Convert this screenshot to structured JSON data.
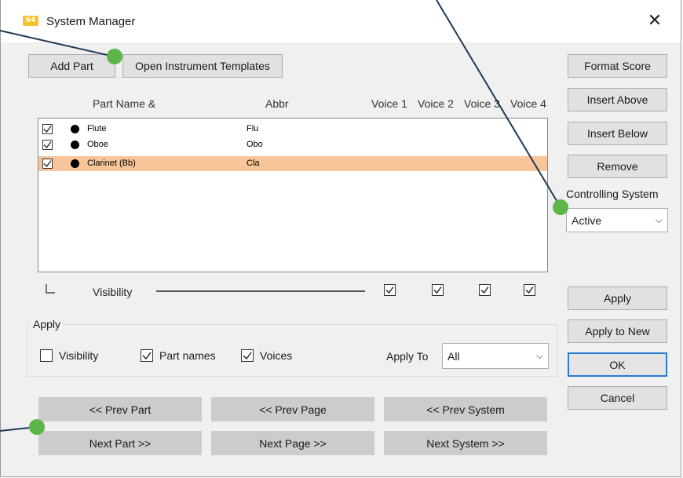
{
  "window": {
    "title": "System Manager",
    "app_icon_text": "64"
  },
  "top_buttons": {
    "add_part": "Add Part",
    "open_templates": "Open Instrument Templates"
  },
  "side_buttons": {
    "format_score": "Format Score",
    "insert_above": "Insert Above",
    "insert_below": "Insert Below",
    "remove": "Remove",
    "controlling_label": "Controlling System",
    "controlling_value": "Active",
    "apply": "Apply",
    "apply_to_new": "Apply to New",
    "ok": "OK",
    "cancel": "Cancel"
  },
  "columns": {
    "part_name": "Part Name &",
    "abbr": "Abbr",
    "voice1": "Voice 1",
    "voice2": "Voice 2",
    "voice3": "Voice 3",
    "voice4": "Voice 4"
  },
  "parts": [
    {
      "name": "Flute",
      "abbr": "Flu",
      "checked": true,
      "selected": false
    },
    {
      "name": "Oboe",
      "abbr": "Obo",
      "checked": true,
      "selected": false
    },
    {
      "name": "Clarinet (Bb)",
      "abbr": "Cla",
      "checked": true,
      "selected": true
    }
  ],
  "visibility_label": "Visibility",
  "apply_group": {
    "label": "Apply",
    "visibility": {
      "label": "Visibility",
      "checked": false
    },
    "part_names": {
      "label": "Part names",
      "checked": true
    },
    "voices": {
      "label": "Voices",
      "checked": true
    },
    "apply_to_label": "Apply To",
    "apply_to_value": "All"
  },
  "nav": {
    "prev_part": "<< Prev Part",
    "prev_page": "<< Prev Page",
    "prev_system": "<< Prev System",
    "next_part": "Next Part >>",
    "next_page": "Next Page >>",
    "next_system": "Next System >>"
  },
  "colors": {
    "selection": "#f7c599",
    "callout": "#5cb548",
    "focus": "#2a7ad2"
  }
}
